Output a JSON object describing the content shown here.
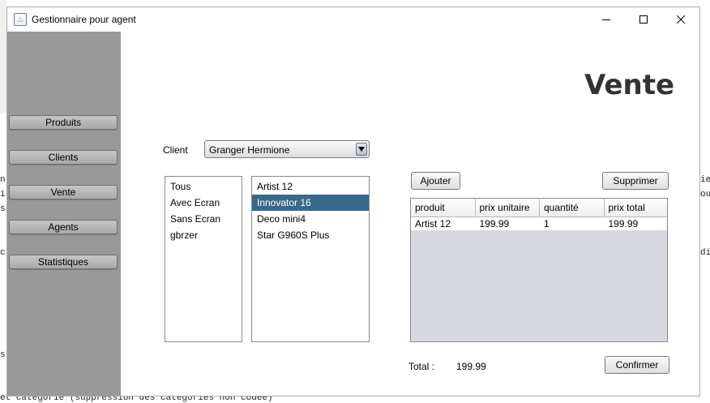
{
  "background": {
    "left_fragments": [
      "n",
      "i",
      "s",
      "c",
      "s"
    ],
    "right_fragments": [
      "ie",
      "ou",
      "di"
    ],
    "bottom_text": "et catégorie (suppression des catégories non codée)"
  },
  "window": {
    "title": "Gestionnaire pour agent",
    "icon": "java-cup-icon",
    "controls": [
      "minimize-icon",
      "maximize-icon",
      "close-icon"
    ]
  },
  "sidebar": {
    "items": [
      {
        "label": "Produits"
      },
      {
        "label": "Clients"
      },
      {
        "label": "Vente"
      },
      {
        "label": "Agents"
      },
      {
        "label": "Statistiques"
      }
    ]
  },
  "main": {
    "title": "Vente",
    "client_label": "Client",
    "client_value": "Granger Hermione",
    "categories": [
      "Tous",
      "Avec Ecran",
      "Sans Ecran",
      "gbrzer"
    ],
    "products": [
      "Artist 12",
      "Innovator 16",
      "Deco mini4",
      "Star G960S Plus"
    ],
    "selected_product": "Innovator 16",
    "add_button": "Ajouter",
    "remove_button": "Supprimer",
    "table": {
      "headers": [
        "produit",
        "prix unitaire",
        "quantité",
        "prix total"
      ],
      "rows": [
        [
          "Artist 12",
          "199.99",
          "1",
          "199.99"
        ]
      ]
    },
    "total_label": "Total :",
    "total_value": "199.99",
    "confirm_button": "Confirmer"
  },
  "colors": {
    "sidebar": "#999999",
    "selection": "#39698a",
    "table_background": "#d6d9df"
  }
}
